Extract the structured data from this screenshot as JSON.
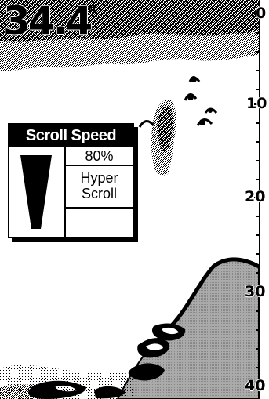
{
  "depth": {
    "value": "34.4",
    "unit": "ft"
  },
  "scale": {
    "labels": [
      "0",
      "10",
      "20",
      "30",
      "40"
    ]
  },
  "popup": {
    "title": "Scroll Speed",
    "value": "80%",
    "mode_line1": "Hyper",
    "mode_line2": "Scroll"
  }
}
